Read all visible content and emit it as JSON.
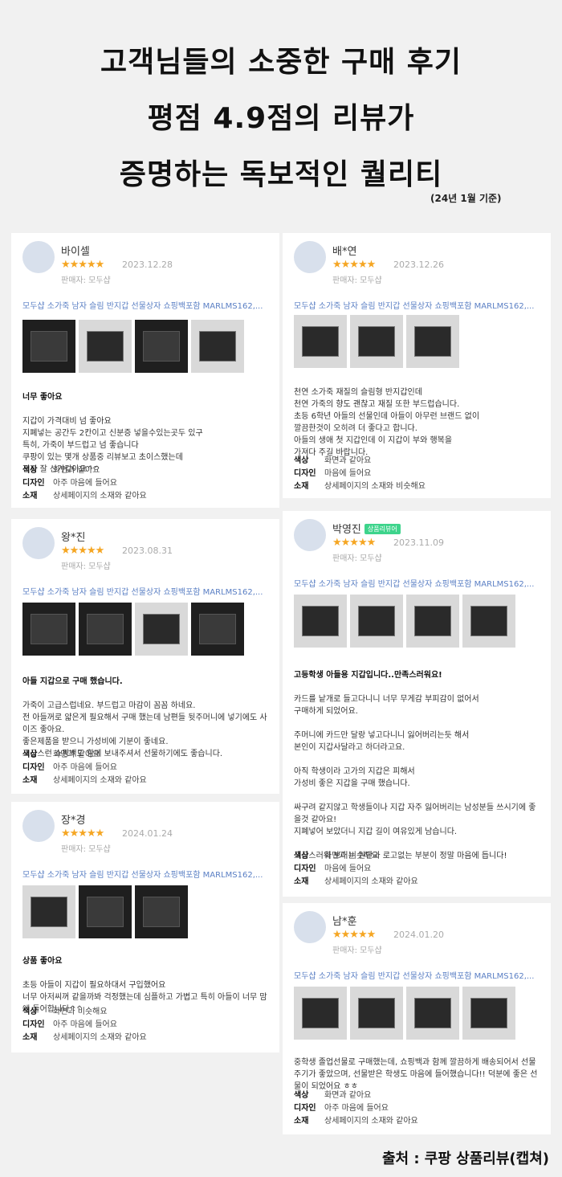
{
  "header": {
    "line1": "고객님들의 소중한 구매 후기",
    "line2": "평점 4.9점의 리뷰가",
    "line3": "증명하는 독보적인 퀄리티",
    "basis": "(24년 1월 기준)"
  },
  "stars": "★★★★★",
  "seller": "판매자: 모두샵",
  "product_name": "모두샵 소가죽 남자 슬림 반지갑 선물상자 쇼핑백포함 MARLMS162,...",
  "attr_labels": {
    "color": "색상",
    "design": "디자인",
    "material": "소재"
  },
  "reviews": [
    {
      "name": "바이셀",
      "date": "2023.12.28",
      "title": "너무 좋아요",
      "text": "지갑이 가격대비 넘 좋아요\n지폐넣는 공간두 2칸이고 신분증 넣을수있는곳두 있구\n특히, 가죽이 부드럽고  넘 좋습니다\n쿠팡이 있는 몇개 상품중 리뷰보고 초이스했는데\n진짜 잘 산거같아요^^",
      "color": "화면과 같아요",
      "design": "아주 마음에 들어요",
      "material": "상세페이지의 소재와 같아요"
    },
    {
      "name": "배*연",
      "date": "2023.12.26",
      "title": "",
      "text": "천연 소가죽 재질의 슬림형 반지갑인데\n천연 가죽의 향도 괜찮고 재질 또한 부드럽습니다.\n초등 6학년 아들의 선물인데 아들이 아무런 브랜드 없이\n깔끔한것이 오히려 더 좋다고 합니다.\n아들의 생애 첫 지갑인데 이 지갑이 부와 행복을\n가져다 주길 바랍니다.",
      "color": "화면과 같아요",
      "design": "마음에 들어요",
      "material": "상세페이지의 소재와 비슷해요"
    },
    {
      "name": "왕*진",
      "date": "2023.08.31",
      "title": "아들 지갑으로 구매 했습니다.",
      "text": "가죽이 고급스럽네요. 부드럽고 마감이 꼼꼼 하네요.\n전 아들꺼로 얇은게 필요해서 구매 했는데 남편들 뒷주머니에 넣기에도 사이즈 좋아요.\n좋은제품을 받으니 가성비에 기분이 좋네요.\n고급스런 쇼핑백도 함께 보내주셔서 선물하기에도 좋습니다.",
      "color": "화면과 같아요",
      "design": "아주 마음에 들어요",
      "material": "상세페이지의 소재와 같아요"
    },
    {
      "name": "박영진",
      "badge": "상품리뷰어",
      "date": "2023.11.09",
      "title": "고등학생 아들용 지갑입니다..만족스러워요!",
      "text": "카드를 낱개로 들고다니니 너무 무게감 부피감이 없어서\n구매하게 되었어요.\n\n주머니에 카드만 달랑 넣고다니니 잃어버리는듯 해서\n본인이 지갑사달라고 하더라고요.\n\n아직 학생이라 고가의 지갑은 피해서\n가성비 좋은 지갑을 구매 했습니다.\n\n싸구려 같지않고 학생들이나 지갑 자주 잃어버리는 남성분들 쓰시기에 좋을것 같아요!\n지폐넣어 보았더니 지갑 길이 여유있게 남습니다.\n\n고급스러워 보이는 원단과 로고없는 부분이 정말 마음에 듭니다!",
      "color": "화면과 비슷해요",
      "design": "마음에 들어요",
      "material": "상세페이지의 소재와 같아요"
    },
    {
      "name": "장*경",
      "date": "2024.01.24",
      "title": "상품 좋아요",
      "text": "초등 아들이 지갑이 필요하대서 구입했어요\n너무 아저씨꺼 같을까봐 걱정했는데 심플하고 가볍고 특히 아들이 너무 맘에 들어합니다^^",
      "color": "화면과 비슷해요",
      "design": "아주 마음에 들어요",
      "material": "상세페이지의 소재와 같아요"
    },
    {
      "name": "남*훈",
      "date": "2024.01.20",
      "title": "",
      "text": "중학생 졸업선물로 구매했는데, 쇼핑백과 함께 깔끔하게 배송되어서 선물주기가 좋았으며, 선물받은 학생도 마음에 들어했습니다!! 덕분에 좋은 선물이 되었어요 ㅎㅎ",
      "color": "화면과 같아요",
      "design": "아주 마음에 들어요",
      "material": "상세페이지의 소재와 같아요"
    }
  ],
  "source": "출처 : 쿠팡 상품리뷰(캡쳐)"
}
